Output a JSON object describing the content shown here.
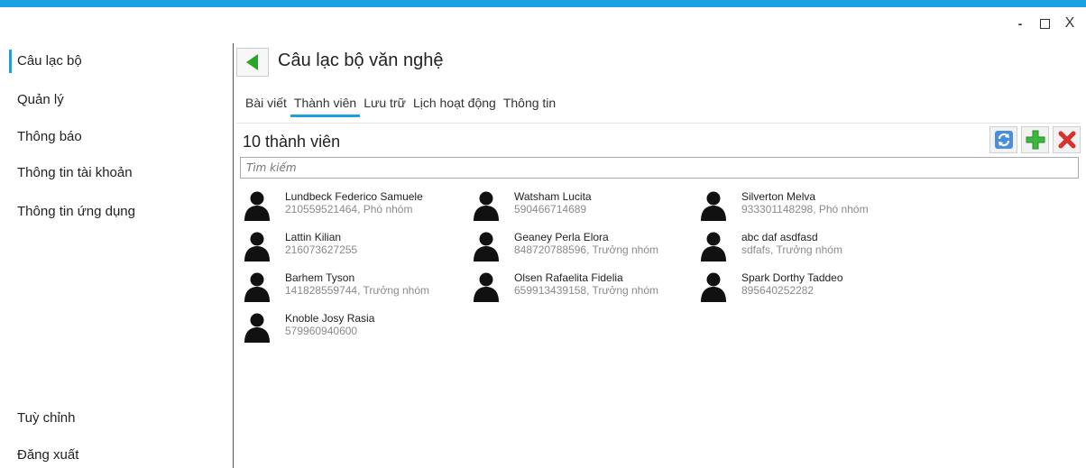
{
  "window": {
    "minimize": "-",
    "maximize": "",
    "close": "X"
  },
  "sidebar": {
    "items": [
      {
        "label": "Câu lạc bộ",
        "active": true
      },
      {
        "label": "Quản lý"
      },
      {
        "label": "Thông báo"
      },
      {
        "label": "Thông tin tài khoản"
      },
      {
        "label": "Thông tin ứng dụng"
      }
    ],
    "bottom_items": [
      {
        "label": "Tuỳ chỉnh"
      },
      {
        "label": "Đăng xuất"
      }
    ]
  },
  "header": {
    "title": "Câu lạc bộ văn nghệ"
  },
  "tabs": [
    {
      "label": "Bài viết"
    },
    {
      "label": "Thành viên",
      "active": true
    },
    {
      "label": "Lưu trữ"
    },
    {
      "label": "Lịch hoạt động"
    },
    {
      "label": "Thông tin"
    }
  ],
  "member_count": "10 thành viên",
  "search": {
    "placeholder": "Tìm kiếm",
    "value": ""
  },
  "toolbar": {
    "icons": [
      "refresh-icon",
      "add-icon",
      "delete-icon"
    ]
  },
  "members": [
    {
      "name": "Lundbeck Federico Samuele",
      "info": "210559521464, Phó nhóm"
    },
    {
      "name": "Watsham Lucita",
      "info": "590466714689"
    },
    {
      "name": "Silverton Melva",
      "info": "933301148298, Phó nhóm"
    },
    {
      "name": "Lattin Kilian",
      "info": "216073627255"
    },
    {
      "name": "Geaney Perla Elora",
      "info": "848720788596, Trưởng nhóm"
    },
    {
      "name": "abc daf asdfasd",
      "info": "sdfafs, Trưởng nhóm"
    },
    {
      "name": "Barhem Tyson",
      "info": "141828559744, Trưởng nhóm"
    },
    {
      "name": "Olsen Rafaelita Fidelia",
      "info": "659913439158, Trưởng nhóm"
    },
    {
      "name": "Spark Dorthy Taddeo",
      "info": "895640252282"
    },
    {
      "name": "Knoble Josy Rasia",
      "info": "579960940600"
    }
  ],
  "colors": {
    "accent": "#1ba1e2",
    "back_arrow": "#2aa52a",
    "add": "#3cb83c",
    "delete": "#d93030"
  }
}
